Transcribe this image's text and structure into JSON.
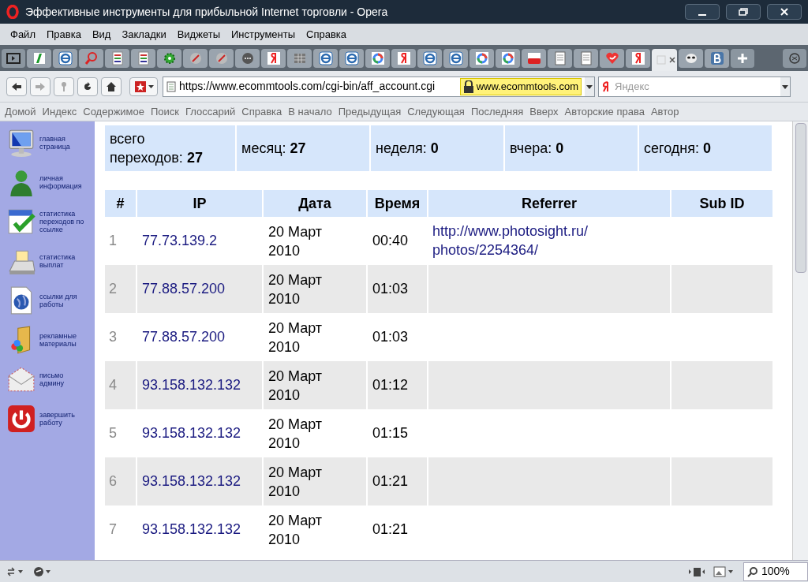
{
  "window": {
    "title": "Эффективные инструменты для прибыльной Internet торговли - Opera"
  },
  "menu": [
    "Файл",
    "Правка",
    "Вид",
    "Закладки",
    "Виджеты",
    "Инструменты",
    "Справка"
  ],
  "tabs": [
    {
      "kind": "green",
      "selected": false
    },
    {
      "kind": "e",
      "selected": false
    },
    {
      "kind": "search",
      "selected": false
    },
    {
      "kind": "doc",
      "selected": false
    },
    {
      "kind": "doc",
      "selected": false
    },
    {
      "kind": "gear",
      "selected": false
    },
    {
      "kind": "globe",
      "selected": false
    },
    {
      "kind": "globe",
      "selected": false
    },
    {
      "kind": "dots",
      "selected": false
    },
    {
      "kind": "yandex",
      "selected": false
    },
    {
      "kind": "grid",
      "selected": false
    },
    {
      "kind": "e",
      "selected": false
    },
    {
      "kind": "e",
      "selected": false
    },
    {
      "kind": "google",
      "selected": false
    },
    {
      "kind": "yandex",
      "selected": false
    },
    {
      "kind": "e",
      "selected": false
    },
    {
      "kind": "e",
      "selected": false
    },
    {
      "kind": "google",
      "selected": false
    },
    {
      "kind": "google",
      "selected": false
    },
    {
      "kind": "youtube",
      "selected": false
    },
    {
      "kind": "page",
      "selected": false
    },
    {
      "kind": "page",
      "selected": false
    },
    {
      "kind": "heart",
      "selected": false
    },
    {
      "kind": "yandex",
      "selected": false
    },
    {
      "kind": "blank",
      "selected": true
    },
    {
      "kind": "mask",
      "selected": false
    },
    {
      "kind": "vk",
      "selected": false
    }
  ],
  "address": {
    "url": "https://www.ecommtools.com/cgi-bin/aff_account.cgi",
    "domain": "www.ecommtools.com"
  },
  "search": {
    "placeholder": "Яндекс"
  },
  "nav_links": [
    "Домой",
    "Индекс",
    "Содержимое",
    "Поиск",
    "Глоссарий",
    "Справка",
    "В начало",
    "Предыдущая",
    "Следующая",
    "Последняя",
    "Вверх",
    "Авторские права",
    "Автор"
  ],
  "sidebar": {
    "items": [
      {
        "kind": "monitor",
        "label": "главная страница"
      },
      {
        "kind": "person",
        "label": "личная информация"
      },
      {
        "kind": "calendar",
        "label": "статистика переходов по ссылке"
      },
      {
        "kind": "register",
        "label": "статистика выплат"
      },
      {
        "kind": "globe",
        "label": "ссылки для работы"
      },
      {
        "kind": "folder",
        "label": "рекламные материалы"
      },
      {
        "kind": "mail",
        "label": "письмо админу"
      },
      {
        "kind": "power",
        "label": "завершить работу"
      }
    ]
  },
  "stats": [
    {
      "label": "всего переходов:",
      "value": "27"
    },
    {
      "label": "месяц:",
      "value": "27"
    },
    {
      "label": "неделя:",
      "value": "0"
    },
    {
      "label": "вчера:",
      "value": "0"
    },
    {
      "label": "сегодня:",
      "value": "0"
    }
  ],
  "table": {
    "columns": [
      "#",
      "IP",
      "Дата",
      "Время",
      "Referrer",
      "Sub ID"
    ],
    "rows": [
      {
        "n": "1",
        "ip": "77.73.139.2",
        "date": "20 Март 2010",
        "time": "00:40",
        "referrer": "http://www.photosight.ru/ photos/2254364/"
      },
      {
        "n": "2",
        "ip": "77.88.57.200",
        "date": "20 Март 2010",
        "time": "01:03"
      },
      {
        "n": "3",
        "ip": "77.88.57.200",
        "date": "20 Март 2010",
        "time": "01:03"
      },
      {
        "n": "4",
        "ip": "93.158.132.132",
        "date": "20 Март 2010",
        "time": "01:12"
      },
      {
        "n": "5",
        "ip": "93.158.132.132",
        "date": "20 Март 2010",
        "time": "01:15"
      },
      {
        "n": "6",
        "ip": "93.158.132.132",
        "date": "20 Март 2010",
        "time": "01:21"
      },
      {
        "n": "7",
        "ip": "93.158.132.132",
        "date": "20 Март 2010",
        "time": "01:21"
      }
    ]
  },
  "status_bar": {
    "zoom": "100%"
  }
}
